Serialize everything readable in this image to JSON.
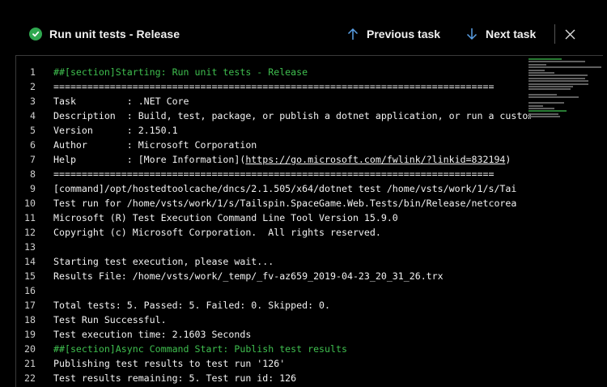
{
  "header": {
    "title": "Run unit tests - Release",
    "previous_label": "Previous task",
    "next_label": "Next task",
    "status_color": "#2fa84f"
  },
  "icons": {
    "status": "success-check-icon",
    "previous": "arrow-up-icon",
    "next": "arrow-down-icon",
    "close": "close-icon"
  },
  "log": {
    "lines": [
      {
        "num": "1",
        "text": "##[section]Starting: Run unit tests - Release",
        "style": "green"
      },
      {
        "num": "2",
        "text": "==============================================================================",
        "style": "normal"
      },
      {
        "num": "3",
        "text": "Task         : .NET Core",
        "style": "normal"
      },
      {
        "num": "4",
        "text": "Description  : Build, test, package, or publish a dotnet application, or run a custom dotnet command",
        "style": "normal"
      },
      {
        "num": "5",
        "text": "Version      : 2.150.1",
        "style": "normal"
      },
      {
        "num": "6",
        "text": "Author       : Microsoft Corporation",
        "style": "normal"
      },
      {
        "num": "7",
        "text": "Help         : [More Information](",
        "style": "link",
        "link": "https://go.microsoft.com/fwlink/?linkid=832194",
        "after": ")"
      },
      {
        "num": "8",
        "text": "==============================================================================",
        "style": "normal"
      },
      {
        "num": "9",
        "text": "[command]/opt/hostedtoolcache/dncs/2.1.505/x64/dotnet test /home/vsts/work/1/s/Tai",
        "style": "normal"
      },
      {
        "num": "10",
        "text": "Test run for /home/vsts/work/1/s/Tailspin.SpaceGame.Web.Tests/bin/Release/netcorea",
        "style": "normal"
      },
      {
        "num": "11",
        "text": "Microsoft (R) Test Execution Command Line Tool Version 15.9.0",
        "style": "normal"
      },
      {
        "num": "12",
        "text": "Copyright (c) Microsoft Corporation.  All rights reserved.",
        "style": "normal"
      },
      {
        "num": "13",
        "text": "",
        "style": "normal"
      },
      {
        "num": "14",
        "text": "Starting test execution, please wait...",
        "style": "normal"
      },
      {
        "num": "15",
        "text": "Results File: /home/vsts/work/_temp/_fv-az659_2019-04-23_20_31_26.trx",
        "style": "normal"
      },
      {
        "num": "16",
        "text": "",
        "style": "normal"
      },
      {
        "num": "17",
        "text": "Total tests: 5. Passed: 5. Failed: 0. Skipped: 0.",
        "style": "normal"
      },
      {
        "num": "18",
        "text": "Test Run Successful.",
        "style": "normal"
      },
      {
        "num": "19",
        "text": "Test execution time: 2.1603 Seconds",
        "style": "normal"
      },
      {
        "num": "20",
        "text": "##[section]Async Command Start: Publish test results",
        "style": "green"
      },
      {
        "num": "21",
        "text": "Publishing test results to test run '126'",
        "style": "normal"
      },
      {
        "num": "22",
        "text": "Test results remaining: 5. Test run id: 126",
        "style": "normal"
      }
    ]
  }
}
